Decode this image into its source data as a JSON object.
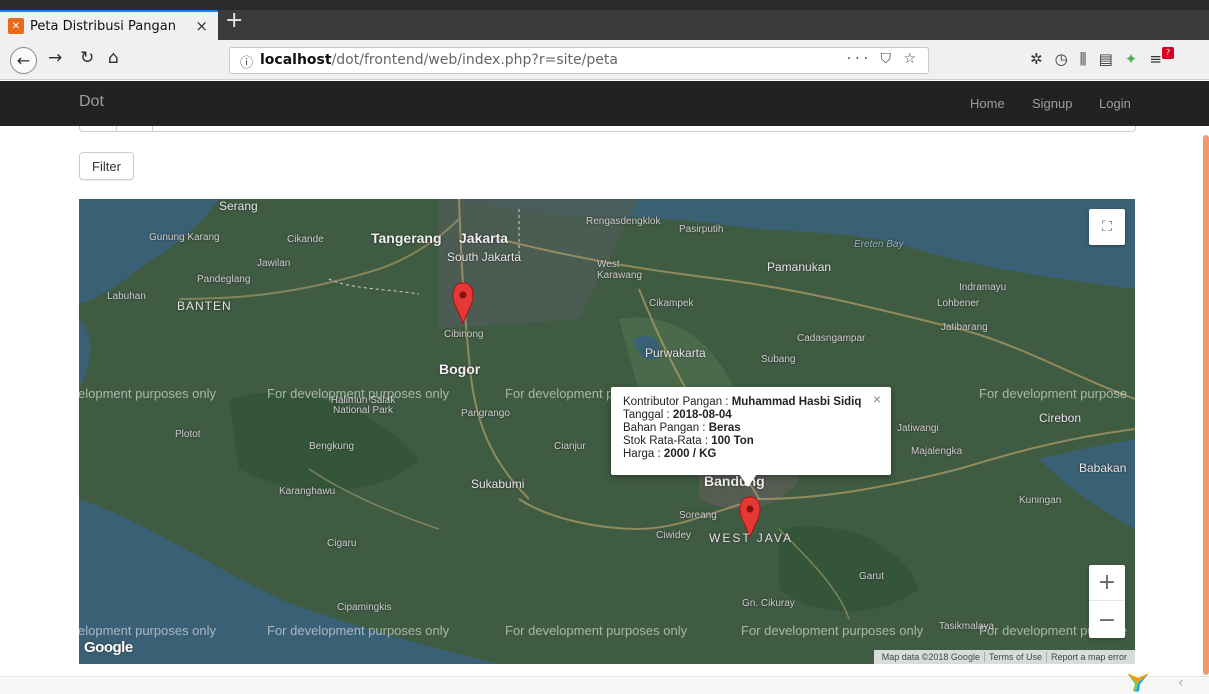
{
  "browser": {
    "tab_title": "Peta Distribusi Pangan",
    "tab_close": "×",
    "new_tab": "+",
    "url_host": "localhost",
    "url_path": "/dot/frontend/web/index.php?r=site/peta",
    "url_right_icons": "··· ⛉ ☆"
  },
  "site": {
    "brand": "Dot",
    "menu": [
      "Home",
      "Signup",
      "Login"
    ]
  },
  "filter_label": "Filter",
  "map": {
    "labels": {
      "serang": "Serang",
      "gunung_karang": "Gunung Karang",
      "cikande": "Cikande",
      "tangerang": "Tangerang",
      "jakarta": "Jakarta",
      "south_jakarta": "South Jakarta",
      "jawilan": "Jawilan",
      "pandeglang": "Pandeglang",
      "labuhan": "Labuhan",
      "banten": "BANTEN",
      "rengasdengklok": "Rengasdengklok",
      "pasirputih": "Pasirputih",
      "ereten_bay": "Ereten Bay",
      "west_karawang": "West Karawang",
      "pamanukan": "Pamanukan",
      "indramayu": "Indramayu",
      "lohbener": "Lohbener",
      "cikampek": "Cikampek",
      "jatibarang": "Jatibarang",
      "cibinong": "Cibinong",
      "cadasngampar": "Cadasngampar",
      "purwakarta": "Purwakarta",
      "subang": "Subang",
      "bogor": "Bogor",
      "halimun": "Halimun Salak National Park",
      "pangrango": "Pangrango",
      "plotot": "Plotot",
      "bengkung": "Bengkung",
      "cianjur": "Cianjur",
      "jatiwangi": "Jatiwangi",
      "majalengka": "Majalengka",
      "cirebon": "Cirebon",
      "babakan": "Babakan",
      "karanghawu": "Karanghawu",
      "sukabumi": "Sukabumi",
      "bandung": "Bandung",
      "kuningan": "Kuningan",
      "soreang": "Soreang",
      "ciwidey": "Ciwidey",
      "west_java": "WEST JAVA",
      "cigaru": "Cigaru",
      "garut": "Garut",
      "gn_cikuray": "Gn. Cikuray",
      "cipamingkis": "Cipamingkis",
      "tasikmalaya": "Tasikmalaya"
    },
    "dev_watermark": "For development purposes only",
    "dev_watermark_left": "elopment purposes only",
    "dev_watermark_right": "For development purpose",
    "google_logo": "Google",
    "footer": [
      "Map data ©2018 Google",
      "Terms of Use",
      "Report a map error"
    ],
    "zoom_in": "+",
    "zoom_out": "−",
    "fullscreen_icon": "⛶"
  },
  "infowindow": {
    "lines": [
      {
        "label": "Kontributor Pangan : ",
        "value": "Muhammad Hasbi Sidiq"
      },
      {
        "label": "Tanggal : ",
        "value": "2018-08-04"
      },
      {
        "label": "Bahan Pangan : ",
        "value": "Beras"
      },
      {
        "label": "Stok Rata-Rata : ",
        "value": "100 Ton"
      },
      {
        "label": "Harga : ",
        "value": "2000 / KG"
      }
    ],
    "close": "×"
  },
  "colors": {
    "marker": "#e53935",
    "navbar": "#222222",
    "map_land": "#3f5b42",
    "map_sea": "#3a6075"
  }
}
